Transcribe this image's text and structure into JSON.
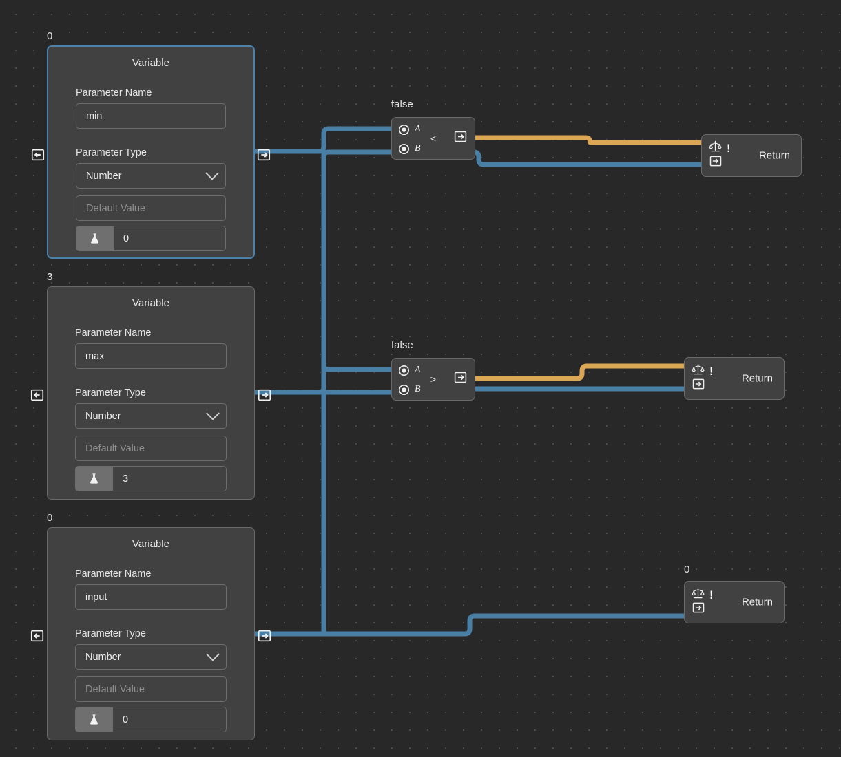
{
  "canvas": {
    "background": "#282828",
    "grid_color": "#4a4a4a",
    "wire_colors": {
      "data": "#4a7fa5",
      "condition": "#dba756"
    }
  },
  "nodes": {
    "variables": [
      {
        "tag": "0",
        "title": "Variable",
        "selected": true,
        "param_name_label": "Parameter Name",
        "param_name_value": "min",
        "param_type_label": "Parameter Type",
        "param_type_value": "Number",
        "default_placeholder": "Default Value",
        "test_value": "0",
        "test_icon": "flask-icon",
        "input_port_icon": "port-in-icon",
        "output_port_icon": "port-out-icon"
      },
      {
        "tag": "3",
        "title": "Variable",
        "selected": false,
        "param_name_label": "Parameter Name",
        "param_name_value": "max",
        "param_type_label": "Parameter Type",
        "param_type_value": "Number",
        "default_placeholder": "Default Value",
        "test_value": "3",
        "test_icon": "flask-icon",
        "input_port_icon": "port-in-icon",
        "output_port_icon": "port-out-icon"
      },
      {
        "tag": "0",
        "title": "Variable",
        "selected": false,
        "param_name_label": "Parameter Name",
        "param_name_value": "input",
        "param_type_label": "Parameter Type",
        "param_type_value": "Number",
        "default_placeholder": "Default Value",
        "test_value": "0",
        "test_icon": "flask-icon",
        "input_port_icon": "port-in-icon",
        "output_port_icon": "port-out-icon"
      }
    ],
    "comparisons": [
      {
        "tag": "false",
        "operator": "<",
        "port_a": "A",
        "port_b": "B",
        "output_port_icon": "port-out-icon"
      },
      {
        "tag": "false",
        "operator": ">",
        "port_a": "A",
        "port_b": "B",
        "output_port_icon": "port-out-icon"
      }
    ],
    "returns": [
      {
        "tag": "",
        "label": "Return",
        "condition_icon": "balance-scale-icon",
        "bang": "!",
        "input_port_icon": "port-in-icon"
      },
      {
        "tag": "",
        "label": "Return",
        "condition_icon": "balance-scale-icon",
        "bang": "!",
        "input_port_icon": "port-in-icon"
      },
      {
        "tag": "0",
        "label": "Return",
        "condition_icon": "balance-scale-icon",
        "bang": "!",
        "input_port_icon": "port-in-icon"
      }
    ]
  }
}
